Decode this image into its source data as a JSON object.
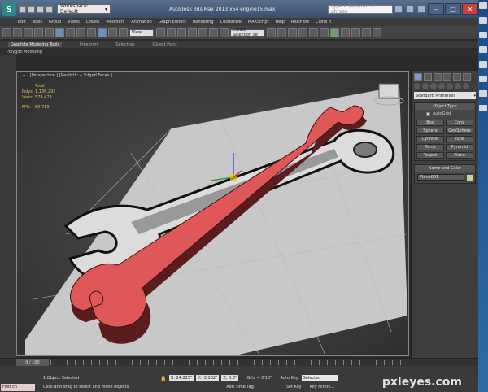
{
  "titlebar": {
    "workspace": "Workspace: Default",
    "title": "Autodesk 3ds Max 2013 x64      engine15.max",
    "search_placeholder": "Type a keyword or phrase"
  },
  "menu": [
    "Edit",
    "Tools",
    "Group",
    "Views",
    "Create",
    "Modifiers",
    "Animation",
    "Graph Editors",
    "Rendering",
    "Customize",
    "MAXScript",
    "Help",
    "RealFlow",
    "Clone It"
  ],
  "toolbar": {
    "view_dropdown": "View",
    "selection_set": "Create Selection Se"
  },
  "ribbon": {
    "tabs": [
      "Graphite Modeling Tools",
      "Freeform",
      "Selection",
      "Object Paint"
    ],
    "sub": "Polygon Modeling"
  },
  "viewport": {
    "label": "[ + ] [Perspective ] [Realistic + Edged Faces ]",
    "stats_header": "Total",
    "polys_label": "Polys:",
    "polys": "1,136,292",
    "verts_label": "Verts:",
    "verts": "578,473",
    "fps_label": "FPS:",
    "fps": "60.719"
  },
  "command_panel": {
    "primitives": "Standard Primitives",
    "object_type_header": "Object Type",
    "autogrid": "AutoGrid",
    "buttons": [
      "Box",
      "Cone",
      "Sphere",
      "GeoSphere",
      "Cylinder",
      "Tube",
      "Torus",
      "Pyramid",
      "Teapot",
      "Plane"
    ],
    "name_color_header": "Name and Color",
    "object_name": "Plane001"
  },
  "timeline": {
    "frame": "0 / 100"
  },
  "status": {
    "maxscript": "First ch",
    "selected": "1 Object Selected",
    "hint": "Click and drag to select and move objects",
    "x": "X: 24.225\"",
    "y": "Y: -3.162\"",
    "z": "Z: 0.0\"",
    "grid": "Grid = 0'10\"",
    "auto_key": "Auto Key",
    "set_key": "Set Key",
    "selected_dropdown": "Selected",
    "key_filters": "Key Filters...",
    "add_time_tag": "Add Time Tag"
  },
  "watermark": "pxleyes.com",
  "colors": {
    "wrench_red": "#e05757",
    "wrench_dark": "#5a1c1c",
    "ground": "#c8c8c8"
  }
}
